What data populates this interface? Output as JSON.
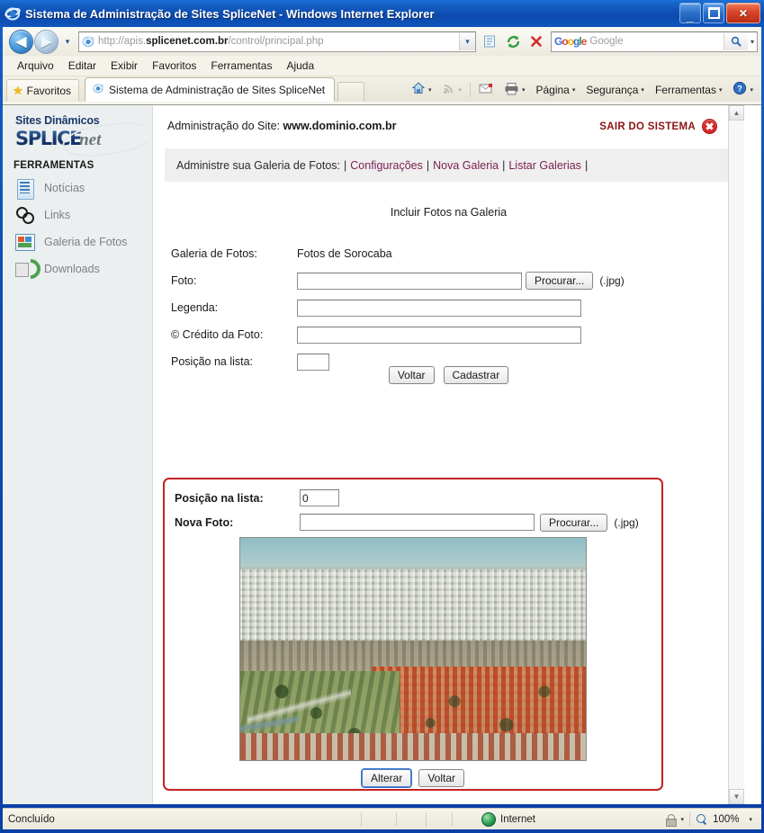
{
  "window": {
    "title": "Sistema de Administração de Sites SpliceNet - Windows Internet Explorer",
    "minimize_label": "_",
    "maximize_label": "",
    "close_label": "✕"
  },
  "browser": {
    "back_label": "◀",
    "forward_label": "▶",
    "recent_pages_label": "▾",
    "address": {
      "protocol_prefix": "http://apis.",
      "domain": "splicenet.com.br",
      "path": "/control/principal.php",
      "dropdown_label": "▾"
    },
    "nav_icons": [
      "compatibility-view-icon",
      "refresh-icon",
      "stop-icon"
    ],
    "search": {
      "provider": "Google",
      "placeholder": "Google",
      "go_label": "🔍",
      "caret_label": "▾"
    },
    "menu": [
      "Arquivo",
      "Editar",
      "Exibir",
      "Favoritos",
      "Ferramentas",
      "Ajuda"
    ],
    "favorites_label": "Favoritos",
    "tab_title": "Sistema de Administração de Sites SpliceNet",
    "command_bar": [
      {
        "label": "",
        "icon": "home-icon",
        "caret": true
      },
      {
        "label": "",
        "icon": "feeds-icon",
        "caret": true
      },
      {
        "label": "",
        "icon": "mail-icon",
        "caret": false
      },
      {
        "label": "",
        "icon": "print-icon",
        "caret": true
      },
      {
        "label": "Página",
        "icon": "",
        "caret": true
      },
      {
        "label": "Segurança",
        "icon": "",
        "caret": true
      },
      {
        "label": "Ferramentas",
        "icon": "",
        "caret": true
      },
      {
        "label": "",
        "icon": "help-icon",
        "caret": true
      }
    ]
  },
  "sidebar": {
    "logo_line1": "Sites Dinâmicos",
    "logo_splice": "SPLICE",
    "logo_net": "net",
    "tools_heading": "FERRAMENTAS",
    "items": [
      {
        "label": "Notícias",
        "icon": "news-icon"
      },
      {
        "label": "Links",
        "icon": "chain-link-icon"
      },
      {
        "label": "Galeria de Fotos",
        "icon": "photo-gallery-icon"
      },
      {
        "label": "Downloads",
        "icon": "downloads-icon"
      }
    ]
  },
  "header": {
    "admin_prefix": "Administração do Site: ",
    "admin_site": "www.dominio.com.br",
    "logout_label": "SAIR DO SISTEMA"
  },
  "navstrip": {
    "prefix": "Administre sua Galeria de Fotos:",
    "links": [
      "Configurações",
      "Nova Galeria",
      "Listar Galerias"
    ],
    "pipe": "|"
  },
  "main": {
    "form_title": "Incluir Fotos na Galeria",
    "fields": {
      "gallery_label": "Galeria de Fotos:",
      "gallery_value": "Fotos de Sorocaba",
      "photo_label": "Foto:",
      "photo_value": "",
      "browse_label": "Procurar...",
      "jpg_note": "(.jpg)",
      "caption_label": "Legenda:",
      "caption_value": "",
      "credit_label": "© Crédito da Foto:",
      "credit_value": "",
      "position_label": "Posição na lista:",
      "position_value": ""
    },
    "buttons": {
      "back_label": "Voltar",
      "submit_label": "Cadastrar"
    }
  },
  "edit_box": {
    "position_label": "Posição na lista:",
    "position_value": "0",
    "new_photo_label": "Nova Foto:",
    "new_photo_value": "",
    "browse_label": "Procurar...",
    "jpg_note": "(.jpg)",
    "photo_alt": "Vista aérea da cidade de Sorocaba",
    "buttons": {
      "change_label": "Alterar",
      "back_label": "Voltar"
    },
    "border_color": "#c42222"
  },
  "statusbar": {
    "status": "Concluído",
    "zone": "Internet",
    "zoom": "100%",
    "caret": "▾"
  },
  "colors": {
    "accent_link": "#7a1f52",
    "logout": "#8b1414",
    "titlebar_blue": "#0c49ad",
    "red_box": "#c42222"
  }
}
